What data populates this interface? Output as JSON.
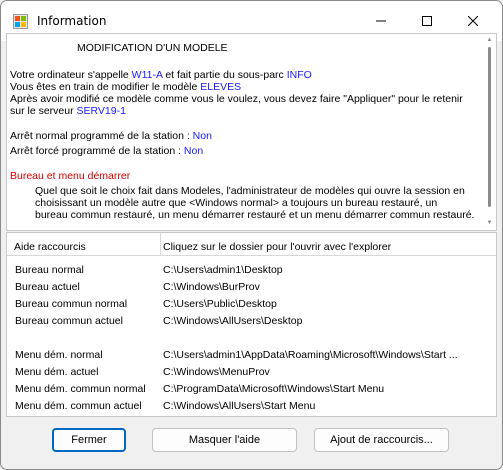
{
  "window": {
    "title": "Information"
  },
  "info": {
    "heading": "MODIFICATION D'UN MODELE",
    "line1_prefix": "Votre ordinateur s'appelle ",
    "computer_name": "W11-A",
    "line1_mid": " et fait partie du sous-parc ",
    "subpark": "INFO",
    "line2_prefix": "Vous êtes en train de modifier le modèle ",
    "model_name": "ELEVES",
    "line3": "Après avoir modifié ce modèle comme vous le voulez, vous devez faire \"Appliquer\" pour le retenir",
    "line4_prefix": "sur le serveur ",
    "server_name": "SERV19-1",
    "stop_normal_label": "Arrêt normal programmé de la station : ",
    "stop_normal_value": "Non",
    "stop_forced_label": "Arrêt forcé programmé de la station : ",
    "stop_forced_value": "Non",
    "section_title": "Bureau et menu démarrer",
    "section_text_1": "Quel que soit le choix fait dans Modeles, l'administrateur de modèles qui ouvre la session en",
    "section_text_2": "choisissant un modèle autre que <Windows normal> a toujours un bureau restauré, un",
    "section_text_3": "bureau commun restauré, un menu démarrer restauré et un menu démarrer commun restauré."
  },
  "shortcuts": {
    "col1_header": "Aide raccourcis",
    "col2_header": "Cliquez sur le dossier pour l'ouvrir avec l'explorer",
    "rows": [
      {
        "label": "Bureau normal",
        "path": "C:\\Users\\admin1\\Desktop"
      },
      {
        "label": "Bureau actuel",
        "path": "C:\\Windows\\BurProv"
      },
      {
        "label": "Bureau commun normal",
        "path": "C:\\Users\\Public\\Desktop"
      },
      {
        "label": "Bureau commun actuel",
        "path": "C:\\Windows\\AllUsers\\Desktop"
      },
      {
        "label": "Menu dém. normal",
        "path": "C:\\Users\\admin1\\AppData\\Roaming\\Microsoft\\Windows\\Start ..."
      },
      {
        "label": "Menu dém. actuel",
        "path": "C:\\Windows\\MenuProv"
      },
      {
        "label": "Menu dém. commun normal",
        "path": "C:\\ProgramData\\Microsoft\\Windows\\Start Menu"
      },
      {
        "label": "Menu dém. commun actuel",
        "path": "C:\\Windows\\AllUsers\\Start Menu"
      }
    ]
  },
  "buttons": {
    "close_label": "Fermer",
    "hide_help_label": "Masquer l'aide",
    "add_shortcuts_label": "Ajout de raccourcis..."
  },
  "colors": {
    "link_blue": "#1a1aff",
    "section_red": "#d40000",
    "focus_border": "#0067c0"
  }
}
